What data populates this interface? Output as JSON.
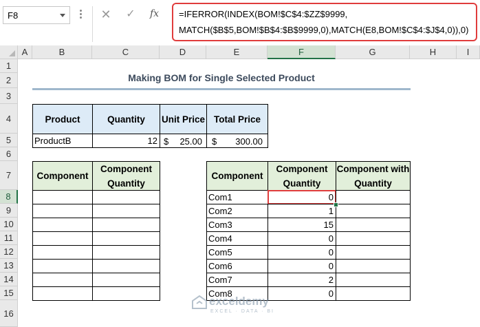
{
  "formula_bar": {
    "name_box": "F8",
    "fx_label": "fx",
    "formula_line1": "=IFERROR(INDEX(BOM!$C$4:$ZZ$9999,",
    "formula_line2": "MATCH($B$5,BOM!$B$4:$B$9999,0),MATCH(E8,BOM!$C$4:$J$4,0)),0)"
  },
  "columns": [
    "A",
    "B",
    "C",
    "D",
    "E",
    "F",
    "G",
    "H",
    "I"
  ],
  "rows": [
    "1",
    "2",
    "3",
    "4",
    "5",
    "6",
    "7",
    "8",
    "9",
    "10",
    "11",
    "12",
    "13",
    "14",
    "15",
    "16"
  ],
  "title": "Making BOM for Single Selected Product",
  "product_table": {
    "headers": [
      "Product",
      "Quantity",
      "Unit Price",
      "Total Price"
    ],
    "row": {
      "product": "ProductB",
      "quantity": "12",
      "unit_cur": "$",
      "unit_price": "25.00",
      "total_cur": "$",
      "total_price": "300.00"
    }
  },
  "left_table": {
    "headers": [
      "Component",
      "Component Quantity"
    ]
  },
  "right_table": {
    "headers": [
      "Component",
      "Component Quantity",
      "Component with Quantity"
    ],
    "rows": [
      {
        "component": "Com1",
        "qty": "0"
      },
      {
        "component": "Com2",
        "qty": "1"
      },
      {
        "component": "Com3",
        "qty": "15"
      },
      {
        "component": "Com4",
        "qty": "0"
      },
      {
        "component": "Com5",
        "qty": "0"
      },
      {
        "component": "Com6",
        "qty": "0"
      },
      {
        "component": "Com7",
        "qty": "2"
      },
      {
        "component": "Com8",
        "qty": "0"
      }
    ]
  },
  "watermark": {
    "name": "exceldemy",
    "sub": "EXCEL · DATA · BI"
  },
  "colors": {
    "selection": "#e03c3c",
    "header_blue": "#ddebf7",
    "header_green": "#e2efda",
    "active_header": "#217346"
  }
}
